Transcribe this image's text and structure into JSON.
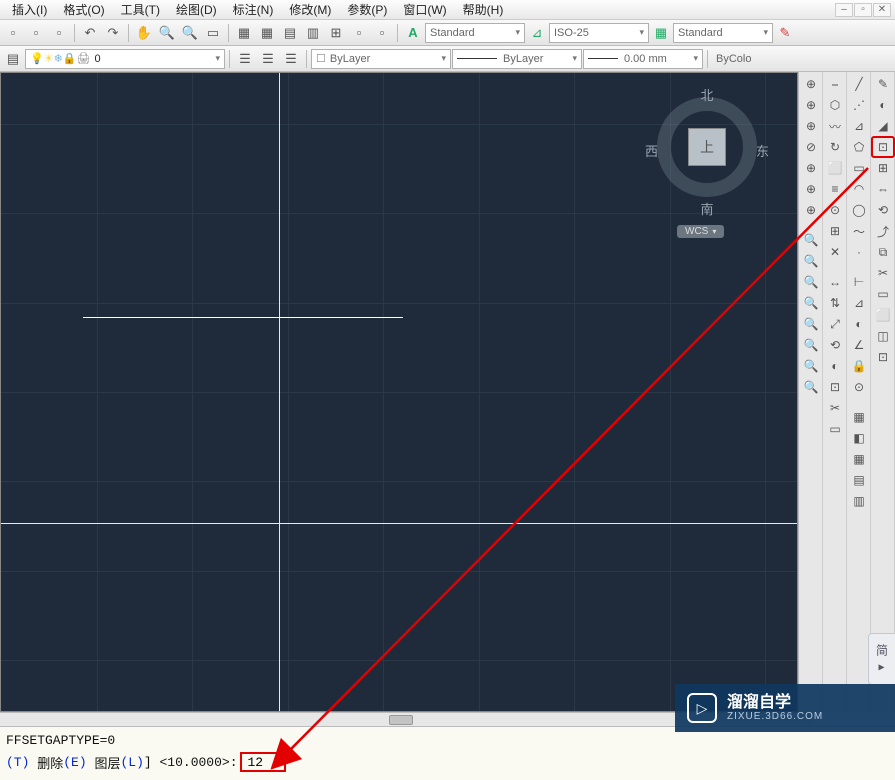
{
  "menu": {
    "items": [
      "插入(I)",
      "格式(O)",
      "工具(T)",
      "绘图(D)",
      "标注(N)",
      "修改(M)",
      "参数(P)",
      "窗口(W)",
      "帮助(H)"
    ]
  },
  "toolbar1": {
    "combo_textstyle": "Standard",
    "combo_dimstyle": "ISO-25",
    "combo_tablestyle": "Standard"
  },
  "toolbar2": {
    "layer_combo": "0",
    "linetype_combo": "ByLayer",
    "linetype2_combo": "ByLayer",
    "lineweight_combo": "0.00 mm",
    "color_combo": "ByColo"
  },
  "viewcube": {
    "north": "北",
    "south": "南",
    "east": "东",
    "west": "西",
    "top": "上",
    "ucs": "WCS"
  },
  "anno_tab": "简 ▸",
  "watermark": {
    "title": "溜溜自学",
    "sub": "ZIXUE.3D66.COM"
  },
  "cmd": {
    "line1": "FFSETGAPTYPE=0",
    "opt_t": "(T)",
    "opt_del_label": "删除",
    "opt_e": "(E)",
    "opt_layer_label": "图层",
    "opt_l": "(L)",
    "default": "<10.0000>:",
    "input_value": "12"
  },
  "icons": {
    "row1": [
      "📄",
      "📂",
      "💾",
      "↶",
      "↷",
      "🖐",
      "🔍+",
      "🔍-",
      "🔲",
      "📑",
      "📋",
      "📏",
      "📐",
      "📊",
      "📎",
      "📌",
      "A"
    ],
    "row2_left": [
      "📁",
      "💡",
      "❄",
      "🔒",
      "🖨",
      "0"
    ],
    "row2_mid": [
      "☰",
      "☰",
      "☰"
    ],
    "row2_right_cb": "☐",
    "style_icon": "A",
    "brush_icon": "🖌",
    "table_icon": "▦",
    "pencil": "✎"
  },
  "right_panels": {
    "col1": [
      "⊕",
      "⊕",
      "⊕",
      "⊘",
      "⊕",
      "⊕",
      "⊕",
      " ",
      "🔍",
      "🔍",
      "🔍",
      "🔍",
      "🔍",
      "🔍",
      "🔍",
      "🔍"
    ],
    "col2": [
      "⎯",
      "⬡",
      "〰",
      "↻",
      "⬜",
      "≡",
      "⊙",
      "⊞",
      "✕",
      " ",
      "↔",
      "⇅",
      "⤢",
      "⟲",
      "◐",
      "⊡",
      "✂",
      "▭"
    ],
    "col3": [
      "✎",
      "⋰",
      "⊿",
      "◫",
      "⬡",
      "◐",
      "◯",
      "〜",
      "·",
      " ",
      "◢",
      "⊡",
      "📏",
      "✎",
      "🔒",
      "⊙",
      " ",
      "⊡",
      "◧",
      "▦",
      "▤",
      "▥"
    ],
    "col4": [
      "✎",
      "◐",
      "⊿",
      "⊡",
      "⊞",
      "⇔",
      "⟲",
      "⤴",
      "⧉",
      "✂",
      "▭",
      "⬜",
      "◫",
      "⊡"
    ]
  }
}
